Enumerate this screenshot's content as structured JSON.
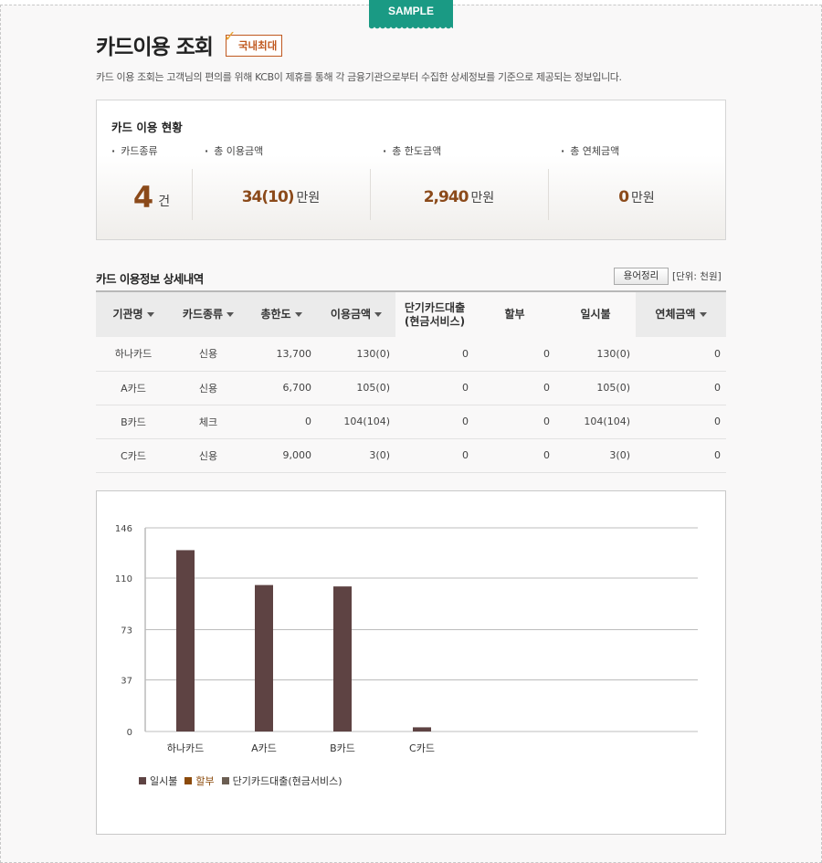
{
  "sample_tab": "SAMPLE",
  "header": {
    "title": "카드이용 조회",
    "badge": "국내최대",
    "description": "카드 이용 조회는 고객님의 편의를 위해 KCB이 제휴를 통해 각 금융기관으로부터 수집한 상세정보를 기준으로 제공되는 정보입니다."
  },
  "summary": {
    "title": "카드 이용 현황",
    "card_types_label": "카드종류",
    "card_count": "4",
    "card_count_unit": "건",
    "total_usage_label": "총 이용금액",
    "total_usage_value": "34(10)",
    "total_usage_unit": "만원",
    "total_limit_label": "총 한도금액",
    "total_limit_value": "2,940",
    "total_limit_unit": "만원",
    "total_overdue_label": "총 연체금액",
    "total_overdue_value": "0",
    "total_overdue_unit": "만원"
  },
  "detail": {
    "title": "카드 이용정보 상세내역",
    "glossary_button": "용어정리",
    "unit_note": "[단위: 천원]",
    "headers": {
      "institution": "기관명",
      "card_type": "카드종류",
      "total_limit": "총한도",
      "usage": "이용금액",
      "short_loan_line1": "단기카드대출",
      "short_loan_line2": "(현금서비스)",
      "installment": "할부",
      "lump_sum": "일시불",
      "overdue": "연체금액"
    },
    "rows": [
      {
        "institution": "하나카드",
        "card_type": "신용",
        "total_limit": "13,700",
        "usage": "130(0)",
        "short_loan": "0",
        "installment": "0",
        "lump_sum": "130(0)",
        "overdue": "0"
      },
      {
        "institution": "A카드",
        "card_type": "신용",
        "total_limit": "6,700",
        "usage": "105(0)",
        "short_loan": "0",
        "installment": "0",
        "lump_sum": "105(0)",
        "overdue": "0"
      },
      {
        "institution": "B카드",
        "card_type": "체크",
        "total_limit": "0",
        "usage": "104(104)",
        "short_loan": "0",
        "installment": "0",
        "lump_sum": "104(104)",
        "overdue": "0"
      },
      {
        "institution": "C카드",
        "card_type": "신용",
        "total_limit": "9,000",
        "usage": "3(0)",
        "short_loan": "0",
        "installment": "0",
        "lump_sum": "3(0)",
        "overdue": "0"
      }
    ]
  },
  "chart_data": {
    "type": "bar",
    "categories": [
      "하나카드",
      "A카드",
      "B카드",
      "C카드"
    ],
    "series": [
      {
        "name": "일시불",
        "values": [
          130,
          105,
          104,
          3
        ],
        "color": "#5e4343"
      },
      {
        "name": "할부",
        "values": [
          0,
          0,
          0,
          0
        ],
        "color": "#8b4a0b"
      },
      {
        "name": "단기카드대출(현금서비스)",
        "values": [
          0,
          0,
          0,
          0
        ],
        "color": "#6b5e52"
      }
    ],
    "yticks": [
      "0",
      "37",
      "73",
      "110",
      "146"
    ],
    "ylim": [
      0,
      146
    ],
    "grid": true,
    "legend_position": "bottom-left"
  },
  "colors": {
    "accent": "#8b4a1a",
    "sample_tab": "#1a9a84",
    "badge": "#c0581f"
  }
}
